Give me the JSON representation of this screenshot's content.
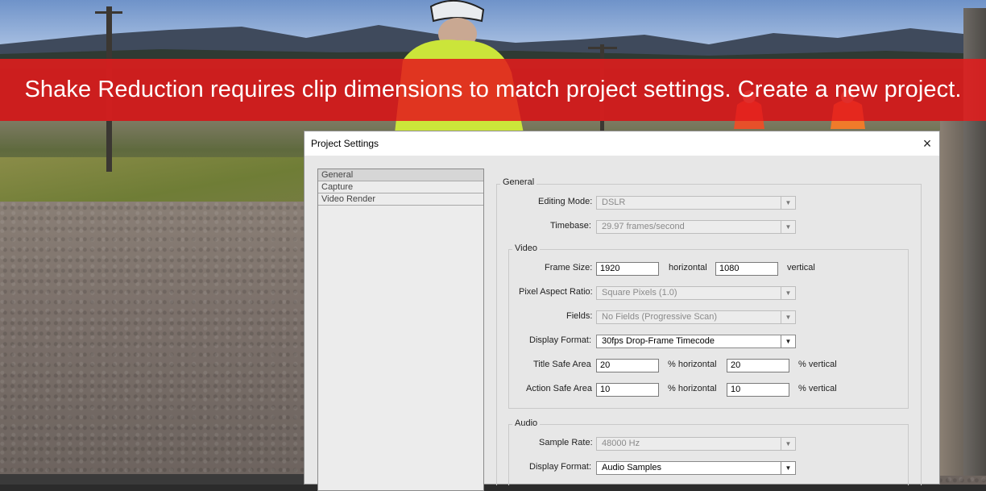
{
  "banner": {
    "message": "Shake Reduction requires clip dimensions to match project settings. Create a new project."
  },
  "dialog": {
    "title": "Project Settings",
    "close_icon": "×",
    "nav": [
      "General",
      "Capture",
      "Video Render"
    ],
    "general": {
      "group_label": "General",
      "editing_mode_label": "Editing Mode:",
      "editing_mode_value": "DSLR",
      "timebase_label": "Timebase:",
      "timebase_value": "29.97  frames/second"
    },
    "video": {
      "group_label": "Video",
      "frame_size_label": "Frame Size:",
      "frame_width": "1920",
      "horizontal_label": "horizontal",
      "frame_height": "1080",
      "vertical_label": "vertical",
      "pixel_aspect_label": "Pixel Aspect Ratio:",
      "pixel_aspect_value": "Square Pixels (1.0)",
      "fields_label": "Fields:",
      "fields_value": "No Fields (Progressive Scan)",
      "display_format_label": "Display Format:",
      "display_format_value": "30fps Drop-Frame Timecode",
      "title_safe_label": "Title Safe Area",
      "title_safe_h": "20",
      "title_safe_h_unit": "% horizontal",
      "title_safe_v": "20",
      "title_safe_v_unit": "% vertical",
      "action_safe_label": "Action Safe Area",
      "action_safe_h": "10",
      "action_safe_h_unit": "% horizontal",
      "action_safe_v": "10",
      "action_safe_v_unit": "% vertical"
    },
    "audio": {
      "group_label": "Audio",
      "sample_rate_label": "Sample Rate:",
      "sample_rate_value": "48000 Hz",
      "display_format_label": "Display Format:",
      "display_format_value": "Audio Samples"
    }
  },
  "colors": {
    "banner_red": "#e21c1c",
    "dialog_bg": "#e7e7e7",
    "titlebar_bg": "#ffffff"
  }
}
